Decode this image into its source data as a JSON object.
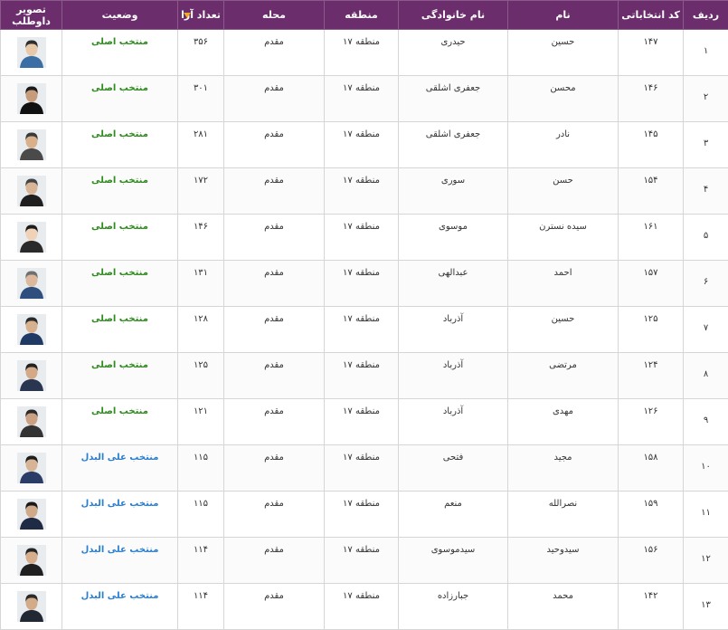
{
  "headers": {
    "row": "ردیف",
    "code": "کد انتخاباتی",
    "first_name": "نام",
    "last_name": "نام خانوادگی",
    "district": "منطقه",
    "locality": "محله",
    "votes": "تعداد آرا",
    "status": "وضعیت",
    "photo": "تصویر داوطلب"
  },
  "rows": [
    {
      "row": "۱",
      "code": "۱۴۷",
      "first_name": "حسین",
      "last_name": "حیدری",
      "district": "منطقه ۱۷",
      "locality": "مقدم",
      "votes": "۳۵۶",
      "status": "منتخب اصلی",
      "status_type": "main"
    },
    {
      "row": "۲",
      "code": "۱۴۶",
      "first_name": "محسن",
      "last_name": "جعفری اشلقی",
      "district": "منطقه ۱۷",
      "locality": "مقدم",
      "votes": "۳۰۱",
      "status": "منتخب اصلی",
      "status_type": "main"
    },
    {
      "row": "۳",
      "code": "۱۴۵",
      "first_name": "نادر",
      "last_name": "جعفری اشلقی",
      "district": "منطقه ۱۷",
      "locality": "مقدم",
      "votes": "۲۸۱",
      "status": "منتخب اصلی",
      "status_type": "main"
    },
    {
      "row": "۴",
      "code": "۱۵۴",
      "first_name": "حسن",
      "last_name": "سوری",
      "district": "منطقه ۱۷",
      "locality": "مقدم",
      "votes": "۱۷۲",
      "status": "منتخب اصلی",
      "status_type": "main"
    },
    {
      "row": "۵",
      "code": "۱۶۱",
      "first_name": "سیده نسترن",
      "last_name": "موسوی",
      "district": "منطقه ۱۷",
      "locality": "مقدم",
      "votes": "۱۴۶",
      "status": "منتخب اصلی",
      "status_type": "main"
    },
    {
      "row": "۶",
      "code": "۱۵۷",
      "first_name": "احمد",
      "last_name": "عبدالهی",
      "district": "منطقه ۱۷",
      "locality": "مقدم",
      "votes": "۱۳۱",
      "status": "منتخب اصلی",
      "status_type": "main"
    },
    {
      "row": "۷",
      "code": "۱۲۵",
      "first_name": "حسین",
      "last_name": "آذرباد",
      "district": "منطقه ۱۷",
      "locality": "مقدم",
      "votes": "۱۲۸",
      "status": "منتخب اصلی",
      "status_type": "main"
    },
    {
      "row": "۸",
      "code": "۱۲۴",
      "first_name": "مرتضی",
      "last_name": "آذرباد",
      "district": "منطقه ۱۷",
      "locality": "مقدم",
      "votes": "۱۲۵",
      "status": "منتخب اصلی",
      "status_type": "main"
    },
    {
      "row": "۹",
      "code": "۱۲۶",
      "first_name": "مهدی",
      "last_name": "آذرباد",
      "district": "منطقه ۱۷",
      "locality": "مقدم",
      "votes": "۱۲۱",
      "status": "منتخب اصلی",
      "status_type": "main"
    },
    {
      "row": "۱۰",
      "code": "۱۵۸",
      "first_name": "مجید",
      "last_name": "فتحی",
      "district": "منطقه ۱۷",
      "locality": "مقدم",
      "votes": "۱۱۵",
      "status": "منتخب علی البدل",
      "status_type": "alt"
    },
    {
      "row": "۱۱",
      "code": "۱۵۹",
      "first_name": "نصرالله",
      "last_name": "منعم",
      "district": "منطقه ۱۷",
      "locality": "مقدم",
      "votes": "۱۱۵",
      "status": "منتخب علی البدل",
      "status_type": "alt"
    },
    {
      "row": "۱۲",
      "code": "۱۵۶",
      "first_name": "سیدوحید",
      "last_name": "سیدموسوی",
      "district": "منطقه ۱۷",
      "locality": "مقدم",
      "votes": "۱۱۴",
      "status": "منتخب علی البدل",
      "status_type": "alt"
    },
    {
      "row": "۱۳",
      "code": "۱۴۲",
      "first_name": "محمد",
      "last_name": "جبارزاده",
      "district": "منطقه ۱۷",
      "locality": "مقدم",
      "votes": "۱۱۴",
      "status": "منتخب علی البدل",
      "status_type": "alt"
    }
  ],
  "colors": {
    "header_bg": "#6b2d6b",
    "status_main": "#2e8b1e",
    "status_alt": "#2a7fd1",
    "sort_indicator": "#f5a623"
  },
  "icons": {
    "sort": "sort-desc-icon",
    "photo": "candidate-photo"
  }
}
